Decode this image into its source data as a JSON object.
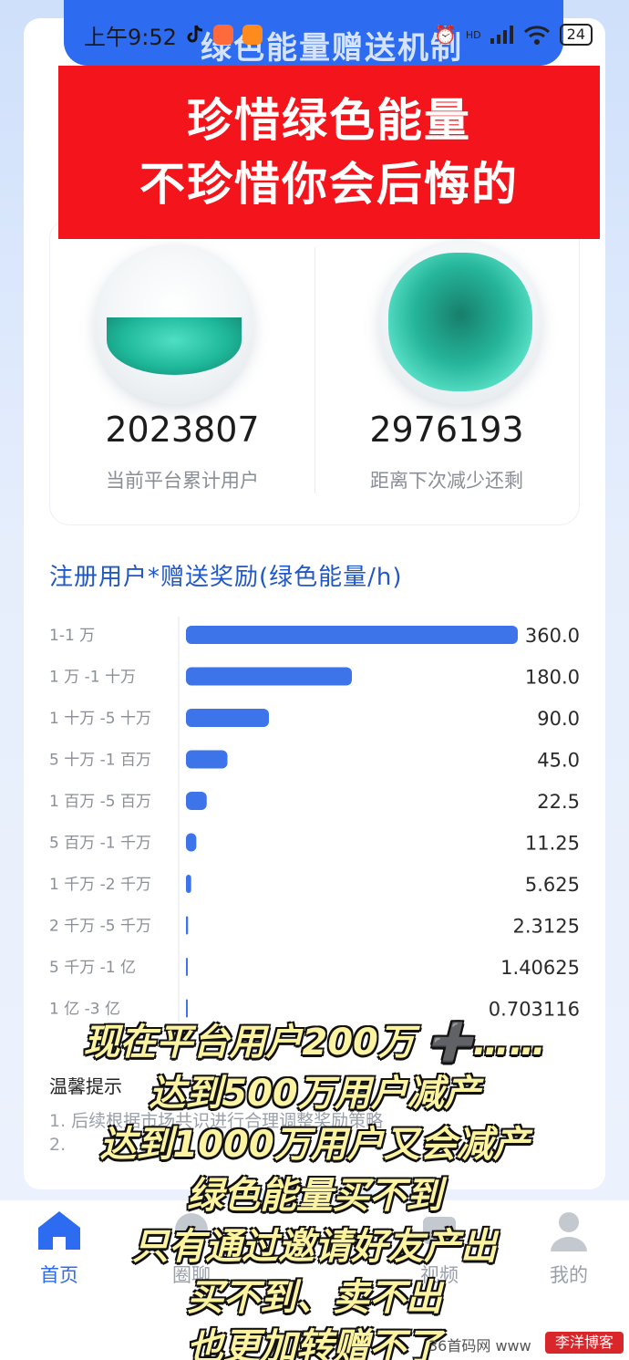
{
  "status_bar": {
    "time": "上午9:52",
    "battery": "24",
    "signal_text": "HD"
  },
  "header": {
    "title": "绿色能量赠送机制"
  },
  "red_banner": {
    "line1": "珍惜绿色能量",
    "line2": "不珍惜你会后悔的"
  },
  "stats": {
    "total_users": "2023807",
    "total_users_label": "当前平台累计用户",
    "remaining": "2976193",
    "remaining_label": "距离下次减少还剩"
  },
  "chart_title": "注册用户*赠送奖励(绿色能量/h)",
  "chart_data": {
    "type": "bar",
    "orientation": "horizontal",
    "title": "注册用户*赠送奖励(绿色能量/h)",
    "categories": [
      "1-1 万",
      "1 万 -1 十万",
      "1 十万 -5 十万",
      "5 十万 -1 百万",
      "1 百万 -5 百万",
      "5 百万 -1 千万",
      "1 千万 -2 千万",
      "2 千万 -5 千万",
      "5 千万 -1 亿",
      "1 亿 -3 亿"
    ],
    "values": [
      360.0,
      180.0,
      90.0,
      45.0,
      22.5,
      11.25,
      5.625,
      2.3125,
      1.40625,
      0.703116
    ],
    "value_labels": [
      "360.0",
      "180.0",
      "90.0",
      "45.0",
      "22.5",
      "11.25",
      "5.625",
      "2.3125",
      "1.40625",
      "0.703116"
    ],
    "bar_color": "#3d74ea",
    "xlim": [
      0,
      360
    ]
  },
  "tips": {
    "title": "温馨提示",
    "line1": "1. 后续根据市场共识进行合理调整奖励策略",
    "line2": "2."
  },
  "bottom_nav": {
    "items": [
      {
        "label": "首页",
        "icon": "home-icon"
      },
      {
        "label": "圈聊",
        "icon": "chat-icon"
      },
      {
        "label": "视频",
        "icon": "video-icon"
      },
      {
        "label": "我的",
        "icon": "profile-icon"
      }
    ]
  },
  "overlay_caption": [
    "现在平台用户200万 ➕……",
    "达到500万用户减产",
    "达到1000万用户又会减产",
    "绿色能量买不到",
    "只有通过邀请好友产出",
    "买不到、卖不出",
    "也更加转赠不了"
  ],
  "watermark": {
    "text": "36首码网 www",
    "badge": "李洋博客"
  },
  "colors": {
    "accent": "#2d6cf0",
    "banner_red": "#f4141b",
    "caption_yellow": "#fbf3a0"
  }
}
